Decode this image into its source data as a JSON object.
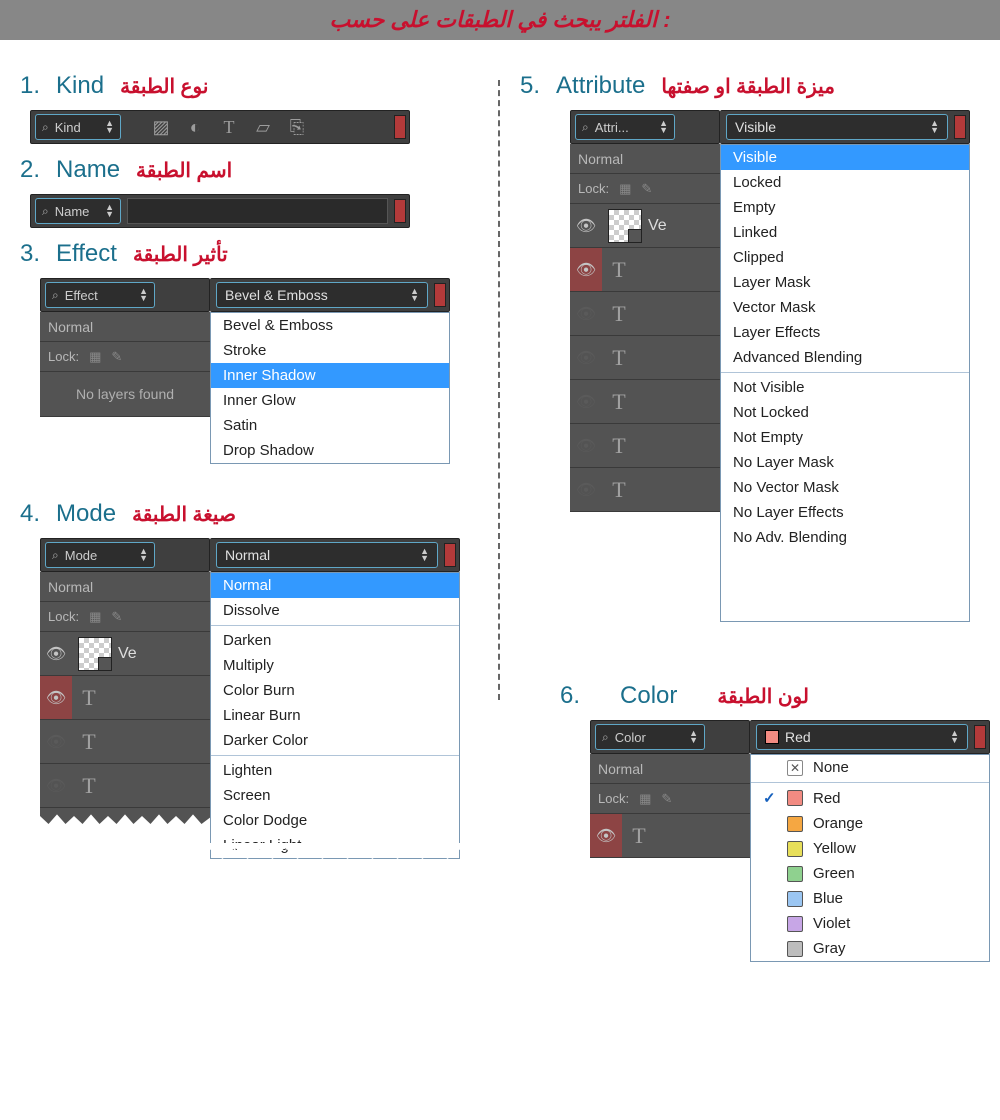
{
  "banner": "الفلتر يبحث في الطبقات على حسب :",
  "sections": {
    "kind": {
      "num": "1.",
      "en": "Kind",
      "ar": "نوع الطبقة"
    },
    "name": {
      "num": "2.",
      "en": "Name",
      "ar": "اسم الطبقة"
    },
    "effect": {
      "num": "3.",
      "en": "Effect",
      "ar": "تأثير الطبقة"
    },
    "mode": {
      "num": "4.",
      "en": "Mode",
      "ar": "صيغة الطبقة"
    },
    "attribute": {
      "num": "5.",
      "en": "Attribute",
      "ar": "ميزة الطبقة او صفتها"
    },
    "color": {
      "num": "6.",
      "en": "Color",
      "ar": "لون الطبقة"
    }
  },
  "filterLabels": {
    "kind": "Kind",
    "name": "Name",
    "effect": "Effect",
    "mode": "Mode",
    "attribute": "Attri...",
    "color": "Color"
  },
  "selected": {
    "effect": "Bevel & Emboss",
    "mode": "Normal",
    "attribute": "Visible",
    "color": "Red"
  },
  "effectOptions": [
    "Bevel & Emboss",
    "Stroke",
    "Inner Shadow",
    "Inner Glow",
    "Satin",
    "Drop Shadow"
  ],
  "effectHighlight": "Inner Shadow",
  "modeOptions1": [
    "Normal",
    "Dissolve"
  ],
  "modeOptions2": [
    "Darken",
    "Multiply",
    "Color Burn",
    "Linear Burn",
    "Darker Color"
  ],
  "modeOptions3": [
    "Lighten",
    "Screen",
    "Color Dodge",
    "Linear Light"
  ],
  "modeHighlight": "Normal",
  "attrOptions1": [
    "Visible",
    "Locked",
    "Empty",
    "Linked",
    "Clipped",
    "Layer Mask",
    "Vector Mask",
    "Layer Effects",
    "Advanced Blending"
  ],
  "attrOptions2": [
    "Not Visible",
    "Not Locked",
    "Not Empty",
    "No Layer Mask",
    "No Vector Mask",
    "No Layer Effects",
    "No Adv. Blending"
  ],
  "attrHighlight": "Visible",
  "colorNone": "None",
  "colorOptions": [
    {
      "name": "Red",
      "hex": "#f28b82"
    },
    {
      "name": "Orange",
      "hex": "#f5a742"
    },
    {
      "name": "Yellow",
      "hex": "#e8df5a"
    },
    {
      "name": "Green",
      "hex": "#8fd18f"
    },
    {
      "name": "Blue",
      "hex": "#9bc6f2"
    },
    {
      "name": "Violet",
      "hex": "#c7a6e6"
    },
    {
      "name": "Gray",
      "hex": "#bdbdbd"
    }
  ],
  "colorChecked": "Red",
  "misc": {
    "normal": "Normal",
    "lock": "Lock:",
    "noLayers": "No layers found",
    "ve": "Ve"
  }
}
